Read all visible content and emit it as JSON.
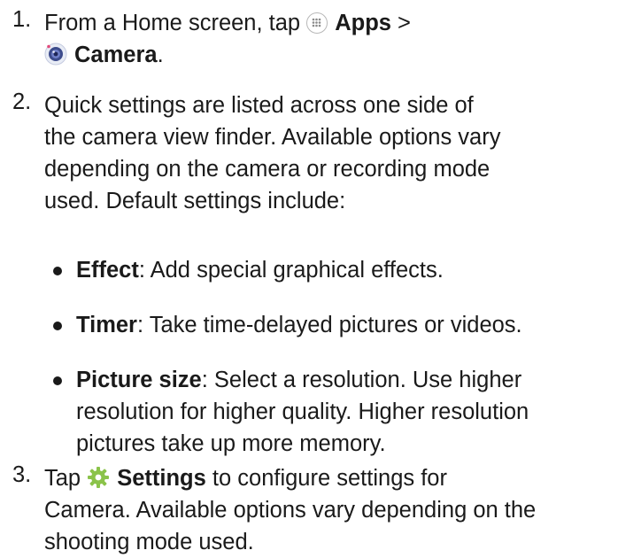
{
  "steps": [
    {
      "number": "1.",
      "line1_before": "From a Home screen, tap",
      "apps_label": "Apps",
      "gt": ">",
      "camera_label": "Camera",
      "period": "."
    },
    {
      "number": "2.",
      "lines": [
        "Quick settings are listed across one side of",
        "the camera view finder. Available options vary",
        "depending on the camera or recording mode",
        "used. Default settings include:"
      ]
    },
    {
      "number": "3.",
      "tap": "Tap",
      "settings_label": "Settings",
      "line1_after": "to configure settings for",
      "line2": "Camera. Available options vary depending on the",
      "line3": "shooting mode used."
    }
  ],
  "bullets": [
    {
      "term": "Effect",
      "lines": [
        ": Add special graphical effects."
      ]
    },
    {
      "term": "Timer",
      "lines": [
        ": Take time-delayed pictures or videos."
      ]
    },
    {
      "term": "Picture size",
      "lines": [
        ": Select a resolution. Use higher",
        "resolution for higher quality. Higher resolution",
        "pictures take up more memory."
      ]
    }
  ],
  "icons": {
    "apps": "apps-grid-icon",
    "camera": "camera-app-icon",
    "settings": "gear-icon"
  },
  "colors": {
    "text": "#1a1a1a",
    "camera_icon_body": "#3d4c8c",
    "camera_icon_accent": "#e24a7a",
    "settings_icon": "#8bc34a"
  }
}
